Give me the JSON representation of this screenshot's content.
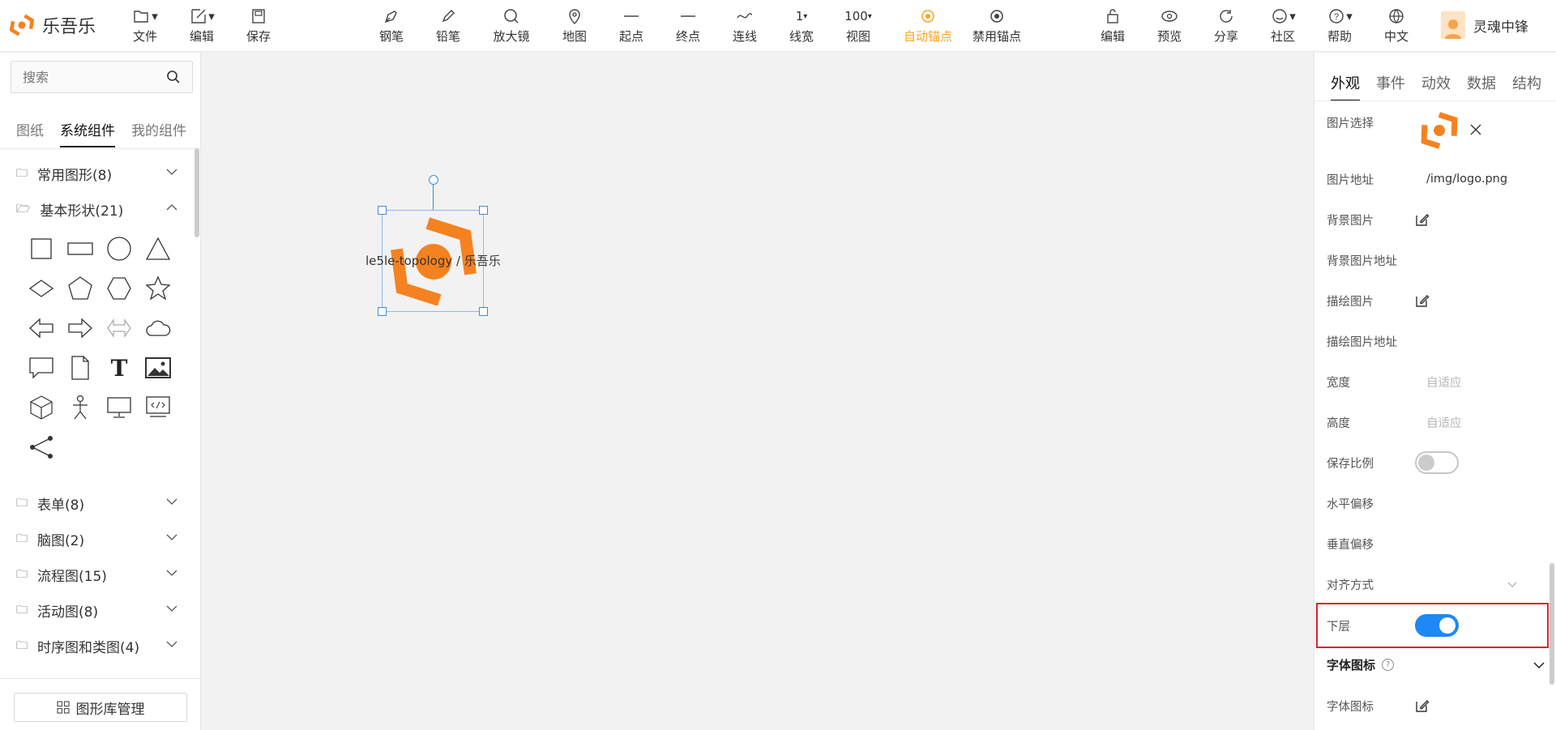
{
  "app": {
    "name": "乐吾乐",
    "brand_color": "#f58220"
  },
  "toolbar": {
    "left": [
      {
        "label": "文件",
        "icon": "folder-icon"
      },
      {
        "label": "编辑",
        "icon": "edit-icon"
      },
      {
        "label": "保存",
        "icon": "save-icon"
      }
    ],
    "center": [
      {
        "label": "钢笔",
        "icon": "pen-icon"
      },
      {
        "label": "铅笔",
        "icon": "pencil-icon"
      },
      {
        "label": "放大镜",
        "icon": "magnifier-icon"
      },
      {
        "label": "地图",
        "icon": "map-pin-icon"
      },
      {
        "label": "起点",
        "icon": "line-start-icon"
      },
      {
        "label": "终点",
        "icon": "line-end-icon"
      },
      {
        "label": "连线",
        "icon": "curve-icon"
      },
      {
        "label": "线宽",
        "value": "1"
      },
      {
        "label": "视图",
        "value": "100"
      },
      {
        "label": "自动锚点",
        "icon": "anchor-auto-icon",
        "active": true
      },
      {
        "label": "禁用锚点",
        "icon": "anchor-disable-icon"
      }
    ],
    "right": [
      {
        "label": "编辑",
        "icon": "lock-icon"
      },
      {
        "label": "预览",
        "icon": "eye-icon"
      },
      {
        "label": "分享",
        "icon": "share-icon"
      },
      {
        "label": "社区",
        "icon": "smile-icon"
      },
      {
        "label": "帮助",
        "icon": "help-icon"
      },
      {
        "label": "中文",
        "icon": "globe-icon"
      }
    ],
    "user": "灵魂中锋"
  },
  "left": {
    "search_placeholder": "搜索",
    "tabs": [
      "图纸",
      "系统组件",
      "我的组件"
    ],
    "groups": [
      {
        "label": "常用图形(8)",
        "open": false
      },
      {
        "label": "基本形状(21)",
        "open": true
      },
      {
        "label": "表单(8)",
        "open": false
      },
      {
        "label": "脑图(2)",
        "open": false
      },
      {
        "label": "流程图(15)",
        "open": false
      },
      {
        "label": "活动图(8)",
        "open": false
      },
      {
        "label": "时序图和类图(4)",
        "open": false
      }
    ],
    "shapes": [
      "square",
      "rectangle",
      "circle",
      "triangle",
      "diamond",
      "pentagon",
      "hexagon",
      "star",
      "left-arrow",
      "right-arrow",
      "two-way-arrow",
      "cloud",
      "message",
      "file",
      "text",
      "image",
      "cube",
      "person",
      "monitor",
      "code",
      "share"
    ],
    "library_button": "图形库管理"
  },
  "canvas": {
    "node_label": "le5le-topology / 乐吾乐"
  },
  "right": {
    "tabs": [
      "外观",
      "事件",
      "动效",
      "数据",
      "结构"
    ],
    "props": {
      "image_select": "图片选择",
      "image_url_label": "图片地址",
      "image_url": "/img/logo.png",
      "bg_image": "背景图片",
      "bg_image_url": "背景图片地址",
      "stroke_image": "描绘图片",
      "stroke_image_url": "描绘图片地址",
      "width": "宽度",
      "width_ph": "自适应",
      "height": "高度",
      "height_ph": "自适应",
      "keep_ratio": "保存比例",
      "h_offset": "水平偏移",
      "v_offset": "垂直偏移",
      "align": "对齐方式",
      "lower_layer": "下层",
      "font_icon_section": "字体图标",
      "font_icon": "字体图标"
    },
    "keep_ratio_on": false,
    "lower_layer_on": true
  }
}
